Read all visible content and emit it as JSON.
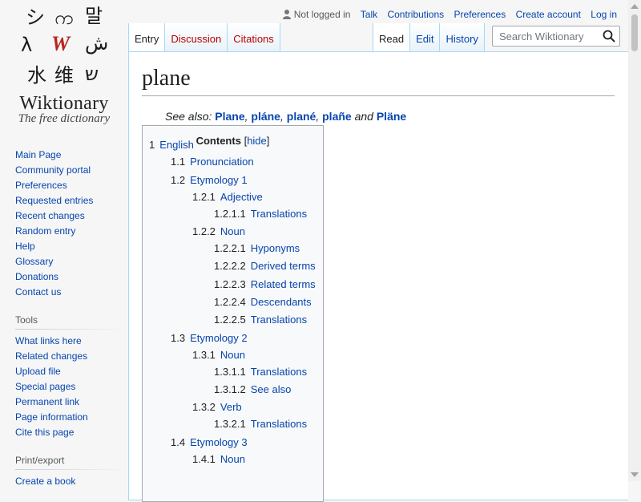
{
  "logo": {
    "glyphs": [
      "シ",
      "က",
      "말",
      "λ",
      "W",
      "ش",
      "水",
      "维",
      "ש"
    ],
    "wordmark": "Wiktionary",
    "tagline": "The free dictionary"
  },
  "sidebar": {
    "nav": [
      "Main Page",
      "Community portal",
      "Preferences",
      "Requested entries",
      "Recent changes",
      "Random entry",
      "Help",
      "Glossary",
      "Donations",
      "Contact us"
    ],
    "tools_heading": "Tools",
    "tools": [
      "What links here",
      "Related changes",
      "Upload file",
      "Special pages",
      "Permanent link",
      "Page information",
      "Cite this page"
    ],
    "print_heading": "Print/export",
    "print": [
      "Create a book"
    ]
  },
  "personal": {
    "status": "Not logged in",
    "links": [
      "Talk",
      "Contributions",
      "Preferences",
      "Create account",
      "Log in"
    ]
  },
  "tabs": {
    "left": [
      {
        "label": "Entry",
        "selected": true
      },
      {
        "label": "Discussion",
        "selected": false
      },
      {
        "label": "Citations",
        "selected": false
      }
    ],
    "right": [
      {
        "label": "Read",
        "selected": true
      },
      {
        "label": "Edit",
        "selected": false
      },
      {
        "label": "History",
        "selected": false
      }
    ]
  },
  "search": {
    "placeholder": "Search Wiktionary",
    "icon": "magnifier-icon"
  },
  "page": {
    "title": "plane",
    "see_also_label": "See also:",
    "see_also": [
      "Plane",
      "pláne",
      "plané",
      "plañe",
      "Pläne"
    ],
    "see_also_and": "and"
  },
  "toc": {
    "title": "Contents",
    "hide_label": "hide",
    "items": [
      {
        "num": "1",
        "text": "English"
      },
      {
        "num": "1.1",
        "text": "Pronunciation"
      },
      {
        "num": "1.2",
        "text": "Etymology 1"
      },
      {
        "num": "1.2.1",
        "text": "Adjective"
      },
      {
        "num": "1.2.1.1",
        "text": "Translations"
      },
      {
        "num": "1.2.2",
        "text": "Noun"
      },
      {
        "num": "1.2.2.1",
        "text": "Hyponyms"
      },
      {
        "num": "1.2.2.2",
        "text": "Derived terms"
      },
      {
        "num": "1.2.2.3",
        "text": "Related terms"
      },
      {
        "num": "1.2.2.4",
        "text": "Descendants"
      },
      {
        "num": "1.2.2.5",
        "text": "Translations"
      },
      {
        "num": "1.3",
        "text": "Etymology 2"
      },
      {
        "num": "1.3.1",
        "text": "Noun"
      },
      {
        "num": "1.3.1.1",
        "text": "Translations"
      },
      {
        "num": "1.3.1.2",
        "text": "See also"
      },
      {
        "num": "1.3.2",
        "text": "Verb"
      },
      {
        "num": "1.3.2.1",
        "text": "Translations"
      },
      {
        "num": "1.4",
        "text": "Etymology 3"
      },
      {
        "num": "1.4.1",
        "text": "Noun"
      }
    ]
  }
}
